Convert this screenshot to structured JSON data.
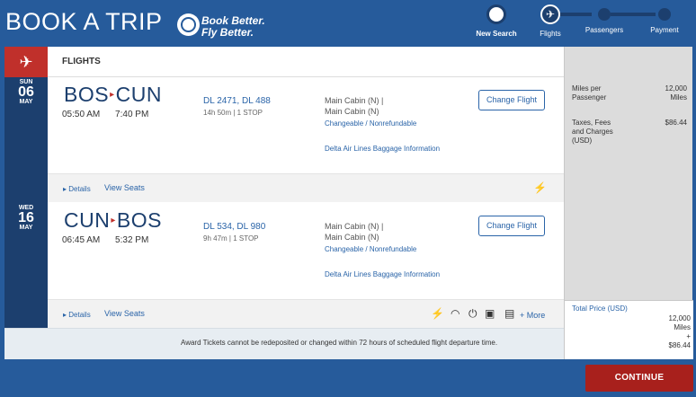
{
  "header": {
    "title": "BOOK A TRIP",
    "tagline_1": "Book Better.",
    "tagline_2": "Fly Better.",
    "steps": [
      {
        "label": "New Search",
        "icon": "refresh-icon"
      },
      {
        "label": "Flights",
        "icon": "airplane-icon",
        "active": true
      },
      {
        "label": "Passengers"
      },
      {
        "label": "Payment"
      }
    ]
  },
  "section_label": "FLIGHTS",
  "segments": [
    {
      "dow": "SUN",
      "day": "06",
      "month": "MAY",
      "from": "BOS",
      "to": "CUN",
      "depart": "05:50 AM",
      "arrive": "7:40 PM",
      "flights": "DL 2471, DL 488",
      "duration": "14h 50m | 1 STOP",
      "cabin_1": "Main Cabin (N) |",
      "cabin_2": "Main Cabin (N)",
      "fare_rule": "Changeable / Nonrefundable",
      "baggage": "Delta Air Lines Baggage Information",
      "change_label": "Change Flight",
      "details": "Details",
      "view_seats": "View Seats",
      "amenities": [
        "wifi-icon"
      ]
    },
    {
      "dow": "WED",
      "day": "16",
      "month": "MAY",
      "from": "CUN",
      "to": "BOS",
      "depart": "06:45 AM",
      "arrive": "5:32 PM",
      "flights": "DL 534, DL 980",
      "duration": "9h 47m | 1 STOP",
      "cabin_1": "Main Cabin (N) |",
      "cabin_2": "Main Cabin (N)",
      "fare_rule": "Changeable / Nonrefundable",
      "baggage": "Delta Air Lines Baggage Information",
      "change_label": "Change Flight",
      "details": "Details",
      "view_seats": "View Seats",
      "amenities": [
        "wifi-logo-icon",
        "wifi-icon",
        "power-icon",
        "movie-icon",
        "entertainment-icon"
      ],
      "more": "+ More"
    }
  ],
  "summary": {
    "miles_label_1": "Miles per",
    "miles_label_2": "Passenger",
    "miles_value": "12,000",
    "miles_unit": "Miles",
    "tax_label_1": "Taxes, Fees",
    "tax_label_2": "and Charges",
    "tax_label_3": "(USD)",
    "tax_value": "$86.44",
    "total_label": "Total Price (USD)",
    "total_miles": "12,000",
    "total_miles_unit": "Miles",
    "total_plus": "+",
    "total_cash": "$86.44"
  },
  "notice": "Award Tickets cannot be redeposited or changed within 72 hours of scheduled flight departure time.",
  "continue_label": "CONTINUE",
  "colors": {
    "brand_blue": "#265b9b",
    "dark_blue": "#1c3f6e",
    "red": "#c0302b",
    "link": "#2a64a8"
  }
}
